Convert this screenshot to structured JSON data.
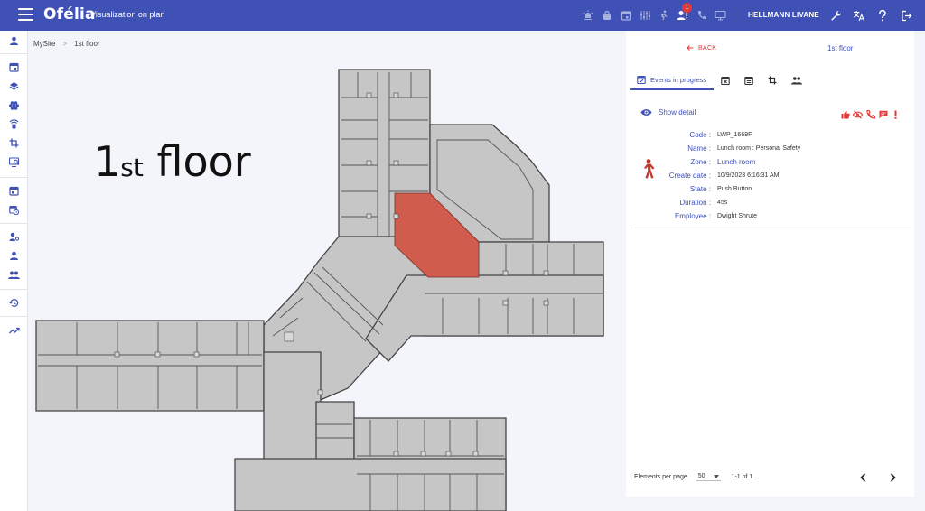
{
  "app": {
    "logo": "Ofélia",
    "title": "Visualization on plan",
    "user_name": "HELLMANN LIVANE",
    "notification_count": "1"
  },
  "top_icons": [
    "alarm-icon",
    "lock-icon",
    "calendar-icon",
    "sensors-icon",
    "walk-icon",
    "user-alert-icon",
    "phone-icon",
    "screen-icon"
  ],
  "right_icons": [
    "wrench-icon",
    "translate-icon",
    "help-icon",
    "logout-icon"
  ],
  "breadcrumb": {
    "site": "MySite",
    "separator": ">",
    "floor": "1st floor"
  },
  "floor_label": {
    "number": "1",
    "suffix": "st",
    "word": "floor"
  },
  "panel": {
    "back_label": "BACK",
    "floor_name": "1st floor",
    "tabs": [
      {
        "name": "events-in-progress",
        "label": "Events in progress",
        "icon": "event-check-icon"
      },
      {
        "name": "cancelled",
        "icon": "calendar-x-icon"
      },
      {
        "name": "schedule",
        "icon": "calendar-list-icon"
      },
      {
        "name": "crop",
        "icon": "crop-icon"
      },
      {
        "name": "people",
        "icon": "people-icon"
      }
    ],
    "show_detail": "Show detail",
    "actions": [
      "thumb-up-icon",
      "eye-off-icon",
      "phone-icon",
      "chat-icon",
      "alert-icon"
    ],
    "details": {
      "code_label": "Code :",
      "code": "LWP_1669F",
      "name_label": "Name :",
      "name": "Lunch room : Personal Safety",
      "zone_label": "Zone :",
      "zone": "Lunch room",
      "create_label": "Create date :",
      "create_date": "10/9/2023 6:16:31 AM",
      "state_label": "State :",
      "state": "Push Button",
      "duration_label": "Duration :",
      "duration": "45s",
      "employee_label": "Employee :",
      "employee": "Dwight Shrute"
    },
    "pager": {
      "elements_label": "Elements per page",
      "page_size": "50",
      "range": "1-1 of 1"
    }
  },
  "colors": {
    "primary": "#3f51b5",
    "alert": "#e53935",
    "zone_highlight": "#cf5c4d",
    "room_fill": "#c5c5c5",
    "wall": "#444444"
  }
}
